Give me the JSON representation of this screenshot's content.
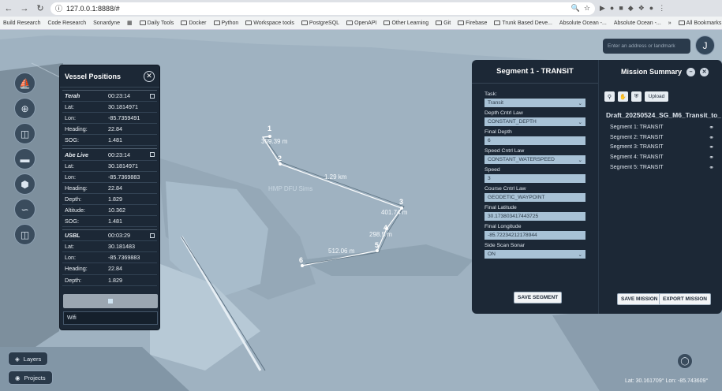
{
  "browser": {
    "url": "127.0.0.1:8888/#",
    "bookmarks": [
      "Build Research",
      "Code Research",
      "Sonardyne",
      "Daily Tools",
      "Docker",
      "Python",
      "Workspace tools",
      "PostgreSQL",
      "OpenAPI",
      "Other Learning",
      "Git",
      "Firebase",
      "Trunk Based Deve...",
      "Absolute Ocean -...",
      "Absolute Ocean -..."
    ],
    "all_bookmarks": "All Bookmarks"
  },
  "search": {
    "placeholder": "Enter an address or landmark"
  },
  "avatar_initial": "J",
  "vessel_panel": {
    "title": "Vessel Positions",
    "vessels": [
      {
        "name": "Terah",
        "time": "00:23:14",
        "rows": [
          [
            "Lat:",
            "30.1814971"
          ],
          [
            "Lon:",
            "-85.7359491"
          ],
          [
            "Heading:",
            "22.84"
          ],
          [
            "SOG:",
            "1.481"
          ]
        ]
      },
      {
        "name": "Abe Live",
        "time": "00:23:14",
        "rows": [
          [
            "Lat:",
            "30.1814971"
          ],
          [
            "Lon:",
            "-85.7369883"
          ],
          [
            "Heading:",
            "22.84"
          ],
          [
            "Depth:",
            "1.829"
          ],
          [
            "Altitude:",
            "10.362"
          ],
          [
            "SOG:",
            "1.481"
          ]
        ]
      },
      {
        "name": "USBL",
        "time": "00:03:29",
        "rows": [
          [
            "Lat:",
            "30.181483"
          ],
          [
            "Lon:",
            "-85.7369883"
          ],
          [
            "Heading:",
            "22.84"
          ],
          [
            "Depth:",
            "1.829"
          ]
        ]
      }
    ],
    "wifi": "Wifi"
  },
  "map": {
    "waypoints": [
      "1",
      "2",
      "3",
      "4",
      "5",
      "6"
    ],
    "distances": [
      "359.39 m",
      "1.29 km",
      "401.74 m",
      "298.5 m",
      "512.06 m"
    ],
    "place_label": "HMP DFU Sims",
    "coords": "Lat: 30.161709° Lon: -85.743609°"
  },
  "left_tools": [
    "Layers",
    "Projects"
  ],
  "segment_panel": {
    "title": "Segment 1 - TRANSIT",
    "fields": [
      {
        "label": "Task:",
        "value": "Transit",
        "select": true
      },
      {
        "label": "Depth Cntrl Law",
        "value": "CONSTANT_DEPTH",
        "select": true
      },
      {
        "label": "Final Depth",
        "value": "6",
        "select": false
      },
      {
        "label": "Speed Cntrl Law",
        "value": "CONSTANT_WATERSPEED",
        "select": true
      },
      {
        "label": "Speed",
        "value": "3",
        "select": false
      },
      {
        "label": "Course Cntrl Law",
        "value": "GEODETIC_WAYPOINT",
        "select": false
      },
      {
        "label": "Final Latitude",
        "value": "30.173803417443725",
        "select": false
      },
      {
        "label": "Final Longitude",
        "value": "-85.72234212178944",
        "select": false
      },
      {
        "label": "Side Scan Sonar",
        "value": "ON",
        "select": true
      }
    ],
    "save": "SAVE SEGMENT"
  },
  "mission_panel": {
    "title": "Mission Summary",
    "upload": "Upload",
    "draft": "Draft_20250524_SG_M6_Transit_to_",
    "segments": [
      "Segment 1: TRANSIT",
      "Segment 2: TRANSIT",
      "Segment 3: TRANSIT",
      "Segment 4: TRANSIT",
      "Segment 5: TRANSIT"
    ],
    "save_mission": "SAVE MISSION",
    "export_mission": "EXPORT MISSION"
  }
}
